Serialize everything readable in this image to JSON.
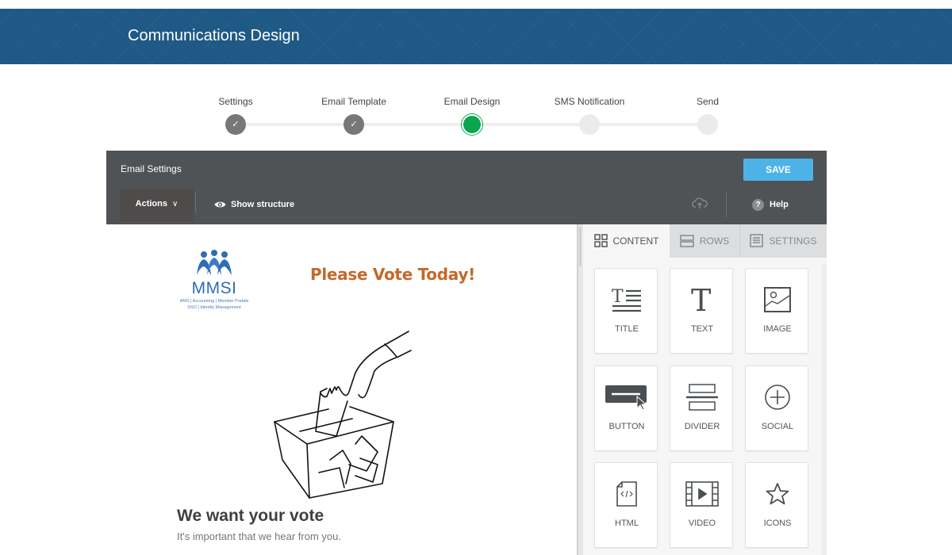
{
  "banner": {
    "title": "Communications Design",
    "color": "#1f5986"
  },
  "stepper": {
    "steps": [
      {
        "label": "Settings",
        "state": "done"
      },
      {
        "label": "Email Template",
        "state": "done"
      },
      {
        "label": "Email Design",
        "state": "active"
      },
      {
        "label": "SMS Notification",
        "state": "pending"
      },
      {
        "label": "Send",
        "state": "pending"
      }
    ],
    "active_color": "#0aa64f",
    "check_glyph": "✓"
  },
  "editor": {
    "title": "Email Settings",
    "save_label": "SAVE",
    "actions_label": "Actions",
    "actions_chevron": "∨",
    "show_structure_label": "Show structure",
    "help_label": "Help",
    "help_glyph": "?"
  },
  "email": {
    "logo_text": "MMSI",
    "logo_sub_1": "AMS | Accounting | Member Portals",
    "logo_sub_2": "SSO  |  Identity Management",
    "headline": "Please Vote Today!",
    "headline_color": "#c5682a",
    "heading": "We want your vote",
    "subtext": "It's important that we hear from you."
  },
  "panel": {
    "tabs": [
      {
        "label": "CONTENT",
        "icon": "grid-icon",
        "active": true
      },
      {
        "label": "ROWS",
        "icon": "rows-icon",
        "active": false
      },
      {
        "label": "SETTINGS",
        "icon": "settings-doc-icon",
        "active": false
      }
    ],
    "tiles": [
      {
        "label": "TITLE",
        "icon": "title-icon"
      },
      {
        "label": "TEXT",
        "icon": "text-icon"
      },
      {
        "label": "IMAGE",
        "icon": "image-icon"
      },
      {
        "label": "BUTTON",
        "icon": "button-icon"
      },
      {
        "label": "DIVIDER",
        "icon": "divider-icon"
      },
      {
        "label": "SOCIAL",
        "icon": "social-icon"
      },
      {
        "label": "HTML",
        "icon": "html-icon"
      },
      {
        "label": "VIDEO",
        "icon": "video-icon"
      },
      {
        "label": "ICONS",
        "icon": "star-icon"
      }
    ]
  }
}
